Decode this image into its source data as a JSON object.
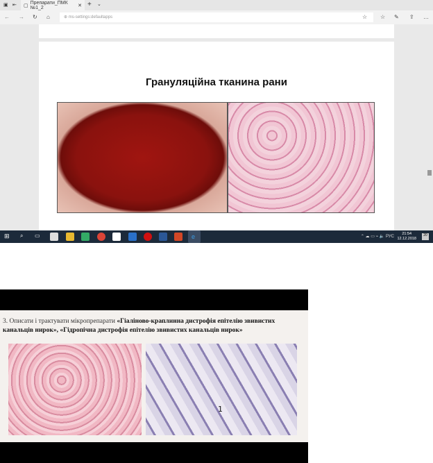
{
  "browser": {
    "tab_title": "Препарати_ПМК №1_2",
    "address": "ms-settings:defaultapps"
  },
  "slide": {
    "title": "Грануляційна тканина рани"
  },
  "taskbar": {
    "language": "РУС",
    "time": "21:54",
    "date": "12.12.2018",
    "notification_count": "20"
  },
  "photo": {
    "task_number": "3.",
    "text_plain": "Описати і трактувати мікропрепарати ",
    "text_bold": "«Гіаліново-краплинна дистрофія епітелію звивистих канальців нирок», «Гідропічна дистрофія епітелію звивистих канальців нирок»",
    "figure_label": "1"
  }
}
